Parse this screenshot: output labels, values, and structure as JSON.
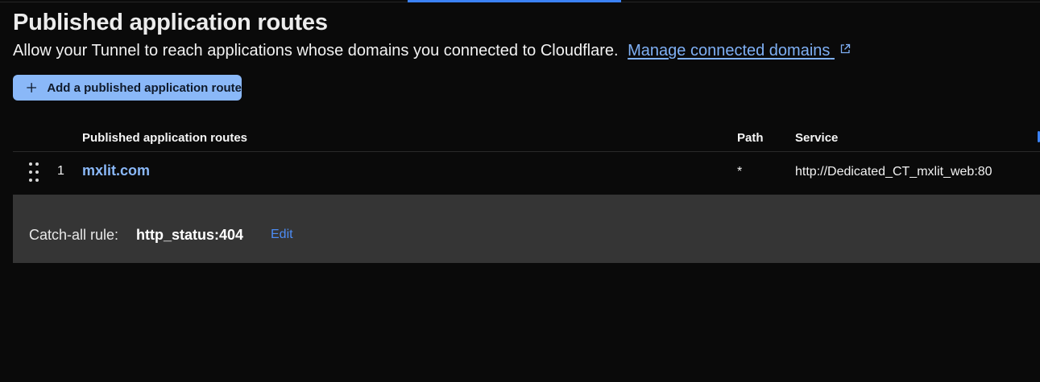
{
  "header": {
    "title": "Published application routes",
    "subtitle": "Allow your Tunnel to reach applications whose domains you connected to Cloudflare.",
    "manage_link": "Manage connected domains"
  },
  "toolbar": {
    "add_label": "Add a published application route"
  },
  "table": {
    "columns": {
      "routes": "Published application routes",
      "path": "Path",
      "service": "Service"
    },
    "rows": [
      {
        "index": "1",
        "hostname": "mxlit.com",
        "path": "*",
        "service": "http://Dedicated_CT_mxlit_web:80"
      }
    ]
  },
  "catchall": {
    "label": "Catch-all rule:",
    "value": "http_status:404",
    "edit_label": "Edit"
  },
  "icons": {
    "add": "plus-icon",
    "external": "external-link-icon",
    "drag": "drag-handle-icon"
  },
  "colors": {
    "accent": "#8ab8f8",
    "link": "#7fb0f5",
    "edit": "#4d8df5",
    "background": "#0a0a0a",
    "catchall_bg": "#353535"
  }
}
